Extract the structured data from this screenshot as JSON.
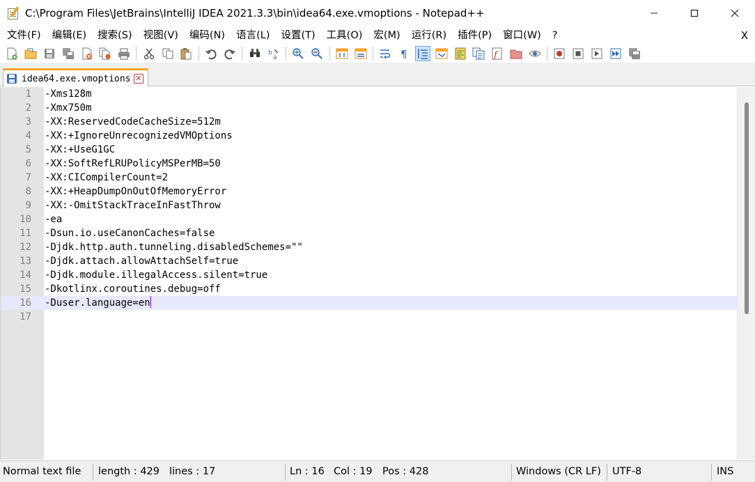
{
  "window": {
    "title": "C:\\Program Files\\JetBrains\\IntelliJ IDEA 2021.3.3\\bin\\idea64.exe.vmoptions - Notepad++",
    "minimize_symbol": "–",
    "maximize_symbol": "☐",
    "close_symbol": "✕"
  },
  "menu": {
    "items": [
      "文件(F)",
      "编辑(E)",
      "搜索(S)",
      "视图(V)",
      "编码(N)",
      "语言(L)",
      "设置(T)",
      "工具(O)",
      "宏(M)",
      "运行(R)",
      "插件(P)",
      "窗口(W)",
      "?"
    ],
    "close_label": "X"
  },
  "toolbar": {
    "icons": [
      "new-file-icon",
      "open-file-icon",
      "save-icon",
      "save-all-icon",
      "close-icon",
      "close-all-icon",
      "print-icon",
      "cut-icon",
      "copy-icon",
      "paste-icon",
      "undo-icon",
      "redo-icon",
      "find-icon",
      "replace-icon",
      "zoom-in-icon",
      "zoom-out-icon",
      "sync-vertical-icon",
      "sync-horizontal-icon",
      "word-wrap-icon",
      "show-all-chars-icon",
      "indent-guide-icon",
      "udl-icon",
      "document-map-icon",
      "document-list-icon",
      "function-list-icon",
      "folder-workspace-icon",
      "monitoring-icon",
      "record-macro-icon",
      "stop-macro-icon",
      "play-macro-icon",
      "run-macro-multiple-icon",
      "save-macro-icon"
    ],
    "colors": {
      "blue": "#3a6fb7",
      "orange": "#f6a623",
      "red": "#c0392b",
      "gray": "#8a8a8a",
      "green": "#4e9a3a"
    }
  },
  "tab": {
    "label": "idea64.exe.vmoptions",
    "close_symbol": "✕"
  },
  "editor": {
    "current_line": 16,
    "lines": [
      {
        "n": "1",
        "text": "-Xms128m"
      },
      {
        "n": "2",
        "text": "-Xmx750m"
      },
      {
        "n": "3",
        "text": "-XX:ReservedCodeCacheSize=512m"
      },
      {
        "n": "4",
        "text": "-XX:+IgnoreUnrecognizedVMOptions"
      },
      {
        "n": "5",
        "text": "-XX:+UseG1GC"
      },
      {
        "n": "6",
        "text": "-XX:SoftRefLRUPolicyMSPerMB=50"
      },
      {
        "n": "7",
        "text": "-XX:CICompilerCount=2"
      },
      {
        "n": "8",
        "text": "-XX:+HeapDumpOnOutOfMemoryError"
      },
      {
        "n": "9",
        "text": "-XX:-OmitStackTraceInFastThrow"
      },
      {
        "n": "10",
        "text": "-ea"
      },
      {
        "n": "11",
        "text": "-Dsun.io.useCanonCaches=false"
      },
      {
        "n": "12",
        "text": "-Djdk.http.auth.tunneling.disabledSchemes=\"\""
      },
      {
        "n": "13",
        "text": "-Djdk.attach.allowAttachSelf=true"
      },
      {
        "n": "14",
        "text": "-Djdk.module.illegalAccess.silent=true"
      },
      {
        "n": "15",
        "text": "-Dkotlinx.coroutines.debug=off"
      },
      {
        "n": "16",
        "text": "-Duser.language=en"
      },
      {
        "n": "17",
        "text": ""
      }
    ]
  },
  "status": {
    "file_type": "Normal text file",
    "length": "length : 429",
    "lines": "lines : 17",
    "ln": "Ln : 16",
    "col": "Col : 19",
    "pos": "Pos : 428",
    "eol": "Windows (CR LF)",
    "encoding": "UTF-8",
    "mode": "INS"
  }
}
